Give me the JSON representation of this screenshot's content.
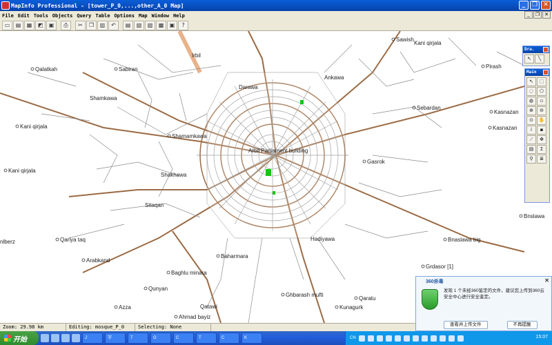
{
  "window": {
    "title": "MapInfo Professional - [tower_P_0,...,other_A_0 Map]",
    "buttons": [
      "_",
      "❐",
      "✕"
    ]
  },
  "menu": {
    "items": [
      "File",
      "Edit",
      "Tools",
      "Objects",
      "Query",
      "Table",
      "Options",
      "Map",
      "Window",
      "Help"
    ],
    "mdi_buttons": [
      "_",
      "❐",
      "✕"
    ]
  },
  "toolbar": {
    "buttons": [
      "new-file-icon",
      "open-file-icon",
      "open-workspace-icon",
      "close-table-icon",
      "save-table-icon",
      "print-icon",
      "cut-icon",
      "copy-icon",
      "paste-icon",
      "undo-icon",
      "new-browser-icon",
      "new-map-icon",
      "new-graph-icon",
      "new-layout-icon",
      "redistrict-icon",
      "help-icon"
    ]
  },
  "map": {
    "labels": [
      {
        "text": "Qalatkah"
      },
      {
        "text": "Sabiran"
      },
      {
        "text": "Irbil"
      },
      {
        "text": "Sawish"
      },
      {
        "text": "Pirash"
      },
      {
        "text": "Kani qirjala"
      },
      {
        "text": "Kani qirjala"
      },
      {
        "text": "Sebardan"
      },
      {
        "text": "Kasnazan"
      },
      {
        "text": "Kasnazan"
      },
      {
        "text": "Shamamkawa"
      },
      {
        "text": "Gasrok"
      },
      {
        "text": "Shakhawa"
      },
      {
        "text": "Bnslawa"
      },
      {
        "text": "Qariya taq"
      },
      {
        "text": "Bnaslawa big"
      },
      {
        "text": "Arabkand"
      },
      {
        "text": "Baharmara"
      },
      {
        "text": "Grdasor [1]"
      },
      {
        "text": "Baghlu minara"
      },
      {
        "text": "Qunyan"
      },
      {
        "text": "Azza"
      },
      {
        "text": "Qatawi"
      },
      {
        "text": "Ghbarash mufti"
      },
      {
        "text": "Kunagurk"
      },
      {
        "text": "Qaratu"
      },
      {
        "text": "Ahmad bayiz"
      },
      {
        "text": "Darawa"
      },
      {
        "text": "Hadiyawa"
      },
      {
        "text": "Arbil Parliament building"
      },
      {
        "text": "Sitaqan"
      },
      {
        "text": "Ankawa"
      },
      {
        "text": "Kani qirjala"
      },
      {
        "text": "Shamkawa"
      },
      {
        "text": "nlberz"
      }
    ]
  },
  "palettes": {
    "drawing": {
      "title": "Dra.",
      "buttons": [
        "selector-icon",
        "line-icon"
      ]
    },
    "main": {
      "title": "Main",
      "buttons": [
        "select-icon",
        "marquee-select-icon",
        "radius-select-icon",
        "polygon-select-icon",
        "boundary-select-icon",
        "unselect-all-icon",
        "zoom-in-icon",
        "zoom-out-icon",
        "change-view-icon",
        "grabber-icon",
        "info-icon",
        "label-icon",
        "ruler-icon",
        "drag-window-icon",
        "legend-icon",
        "statistics-icon",
        "hotlink-icon",
        "layer-control-icon"
      ]
    }
  },
  "status": {
    "zoom": "Zoom: 29.98 km",
    "editing": "Editing: mosque_P_0",
    "selecting": "Selecting: None"
  },
  "taskbar": {
    "start": "开始",
    "tasks": [
      "J",
      "字",
      "T",
      "G",
      "C",
      "T",
      "C",
      "K"
    ],
    "tray_text": "CN",
    "clock": "15:07"
  },
  "popup": {
    "title": "360杀毒",
    "message": "发现 1 个未经360鉴定的文件，建议您上传到360云安全中心进行安全鉴定。",
    "btn_upload": "查看并上传文件",
    "btn_ignore": "不再提醒",
    "close": "✕"
  }
}
